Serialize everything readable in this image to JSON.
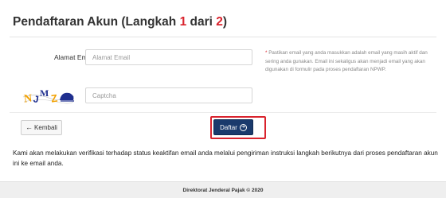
{
  "header": {
    "title_prefix": "Pendaftaran Akun  (Langkah ",
    "step_current": "1",
    "title_middle": " dari ",
    "step_total": "2",
    "title_suffix": ")"
  },
  "form": {
    "email_label": "Alamat Email",
    "required_mark": "*",
    "email_placeholder": "Alamat Email",
    "email_value": "",
    "captcha_placeholder": "Captcha",
    "captcha_value": "",
    "note_mark": "*",
    "note": "Pastikan email yang anda masukkan adalah email yang masih aktif dan sering anda gunakan. Email ini sekaligus akan menjadi email yang akan digunakan di formulir pada proses pendaftaran NPWP.",
    "captcha_text": "NJMZ"
  },
  "actions": {
    "back_label": "Kembali",
    "back_icon": "arrow-circle-left-icon",
    "submit_label": "Daftar",
    "submit_icon": "arrow-circle-right-icon",
    "highlight_color": "#d9232d",
    "submit_color": "#1a3a6c"
  },
  "info": "Kami akan melakukan verifikasi terhadap status keaktifan email anda melalui pengiriman instruksi langkah berikutnya dari proses pendaftaran akun ini ke email anda.",
  "footer": {
    "copyright": "Direktorat Jenderal Pajak © 2020"
  }
}
